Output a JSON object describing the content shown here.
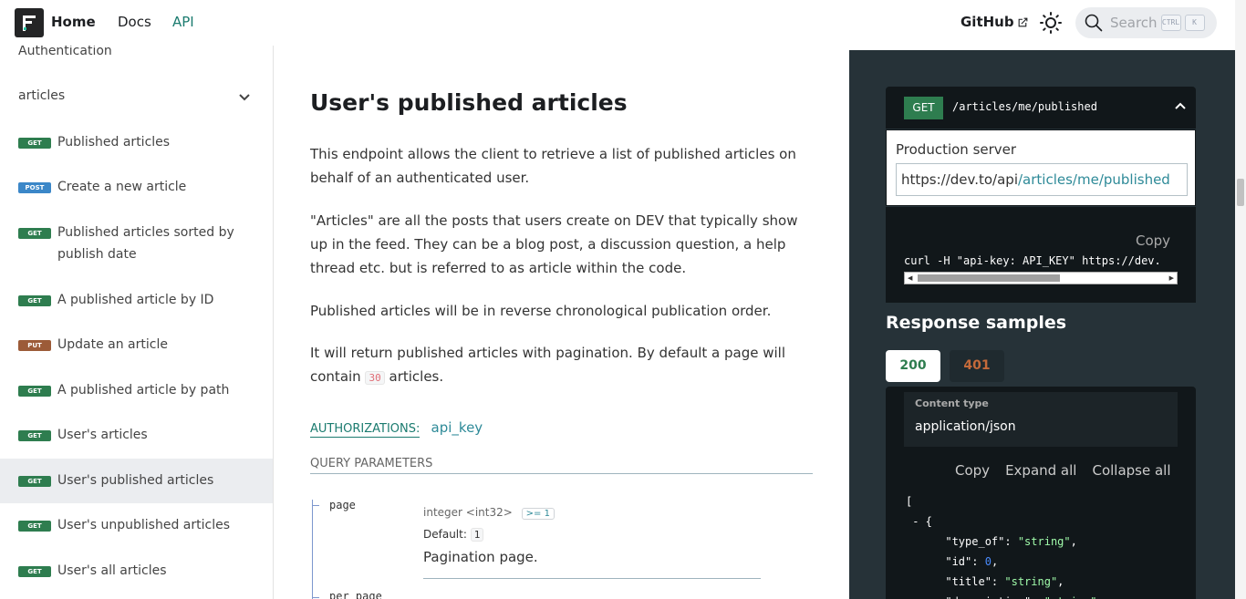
{
  "nav": {
    "home": "Home",
    "docs": "Docs",
    "api": "API",
    "github": "GitHub",
    "search_placeholder": "Search",
    "kbd1": "CTRL",
    "kbd2": "K"
  },
  "sidebar": {
    "auth": "Authentication",
    "category": "articles",
    "items": [
      {
        "method": "GET",
        "label": "Published articles"
      },
      {
        "method": "POST",
        "label": "Create a new article"
      },
      {
        "method": "GET",
        "label": "Published articles sorted by publish date"
      },
      {
        "method": "GET",
        "label": "A published article by ID"
      },
      {
        "method": "PUT",
        "label": "Update an article"
      },
      {
        "method": "GET",
        "label": "A published article by path"
      },
      {
        "method": "GET",
        "label": "User's articles"
      },
      {
        "method": "GET",
        "label": "User's published articles"
      },
      {
        "method": "GET",
        "label": "User's unpublished articles"
      },
      {
        "method": "GET",
        "label": "User's all articles"
      }
    ]
  },
  "main": {
    "title": "User's published articles",
    "p1": "This endpoint allows the client to retrieve a list of published articles on behalf of an authenticated user.",
    "p2": "\"Articles\" are all the posts that users create on DEV that typically show up in the feed. They can be a blog post, a discussion question, a help thread etc. but is referred to as article within the code.",
    "p3": "Published articles will be in reverse chronological publication order.",
    "p4_pre": "It will return published articles with pagination. By default a page will contain",
    "p4_code": "30",
    "p4_post": "articles.",
    "auth_label": "AUTHORIZATIONS:",
    "auth_value": "api_key",
    "qp_label": "QUERY PARAMETERS",
    "param1": {
      "name": "page",
      "type": "integer <int32>",
      "constraint": ">= 1",
      "default_label": "Default:",
      "default_value": "1",
      "description": "Pagination page."
    },
    "param2": {
      "name": "per_page"
    }
  },
  "right": {
    "method": "GET",
    "path": "/articles/me/published",
    "server_title": "Production server",
    "server_base": "https://dev.to/api",
    "server_path": "/articles/me/published",
    "copy": "Copy",
    "curl": "curl -H \"api-key: API_KEY\" https://dev.",
    "resp_title": "Response samples",
    "tab200": "200",
    "tab401": "401",
    "content_type_label": "Content type",
    "content_type_value": "application/json",
    "copy2": "Copy",
    "expand_all": "Expand all",
    "collapse_all": "Collapse all"
  }
}
